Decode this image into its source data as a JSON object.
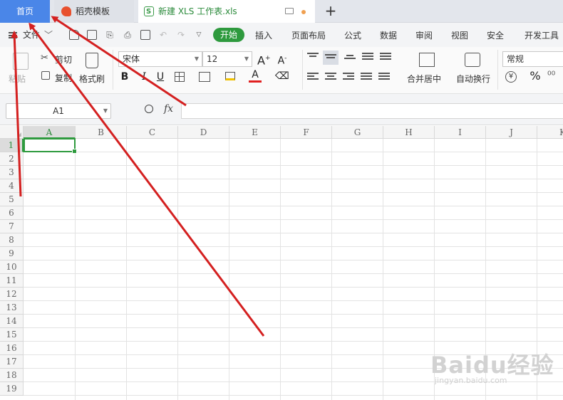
{
  "tabs": {
    "home": "首页",
    "docer": "稻壳模板",
    "sheet": "新建 XLS 工作表.xls",
    "add": "+"
  },
  "menu": {
    "file": "文件",
    "items": [
      "开始",
      "插入",
      "页面布局",
      "公式",
      "数据",
      "审阅",
      "视图",
      "安全",
      "开发工具"
    ],
    "active": "开始"
  },
  "ribbon": {
    "paste": "粘贴",
    "cut": "剪切",
    "copy": "复制",
    "format_painter": "格式刷",
    "font_name": "宋体",
    "font_size": "12",
    "bold": "B",
    "italic": "I",
    "underline": "U",
    "merge_center": "合并居中",
    "wrap_text": "自动换行",
    "number_format": "常规",
    "percent": "%"
  },
  "formula_bar": {
    "name_box": "A1",
    "fx": "fx",
    "value": ""
  },
  "grid": {
    "columns": [
      "A",
      "B",
      "C",
      "D",
      "E",
      "F",
      "G",
      "H",
      "I",
      "J",
      "K"
    ],
    "rows": [
      "1",
      "2",
      "3",
      "4",
      "5",
      "6",
      "7",
      "8",
      "9",
      "10",
      "11",
      "12",
      "13",
      "14",
      "15",
      "16",
      "17",
      "18",
      "19"
    ],
    "active_cell": "A1"
  },
  "watermark": {
    "brand": "Baidu经验",
    "url": "jingyan.baidu.com"
  },
  "colors": {
    "home_tab": "#4a86e8",
    "accent_green": "#2e9a3e",
    "annotation": "#d42020"
  }
}
